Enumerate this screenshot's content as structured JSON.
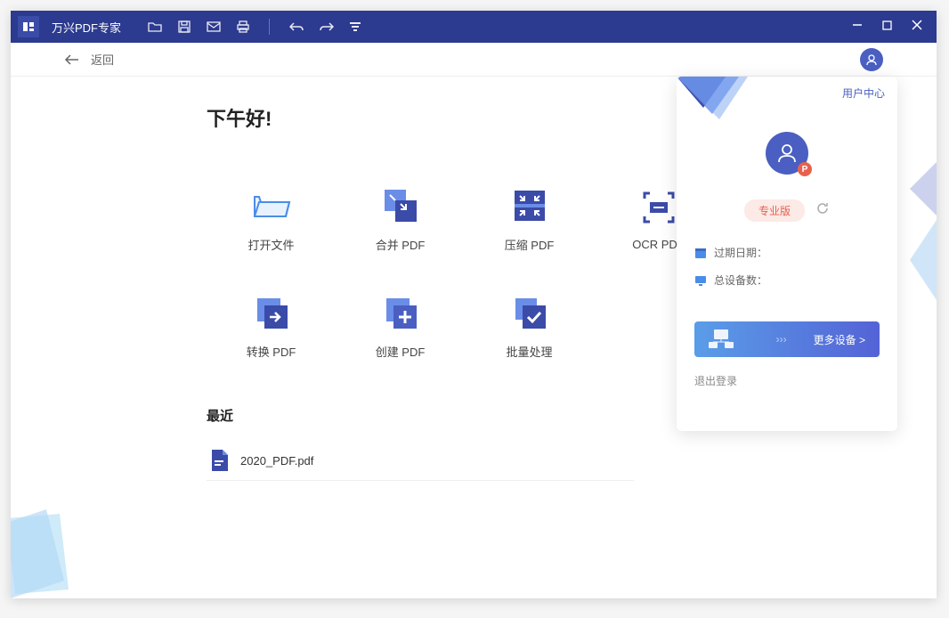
{
  "titlebar": {
    "title": "万兴PDF专家"
  },
  "subheader": {
    "back_label": "返回"
  },
  "main": {
    "greeting": "下午好!",
    "actions": [
      {
        "label": "打开文件",
        "name": "open-file"
      },
      {
        "label": "合并 PDF",
        "name": "merge-pdf"
      },
      {
        "label": "压缩 PDF",
        "name": "compress-pdf"
      },
      {
        "label": "OCR PDF",
        "name": "ocr-pdf"
      },
      {
        "label": "转换 PDF",
        "name": "convert-pdf"
      },
      {
        "label": "创建 PDF",
        "name": "create-pdf"
      },
      {
        "label": "批量处理",
        "name": "batch-process"
      }
    ],
    "recent_title": "最近",
    "recent_files": [
      {
        "name": "2020_PDF.pdf"
      }
    ]
  },
  "user_panel": {
    "center_link": "用户中心",
    "avatar_badge": "P",
    "pro_label": "专业版",
    "expire_label": "过期日期：",
    "devices_label": "总设备数：",
    "more_devices": "更多设备 >",
    "logout": "退出登录"
  }
}
